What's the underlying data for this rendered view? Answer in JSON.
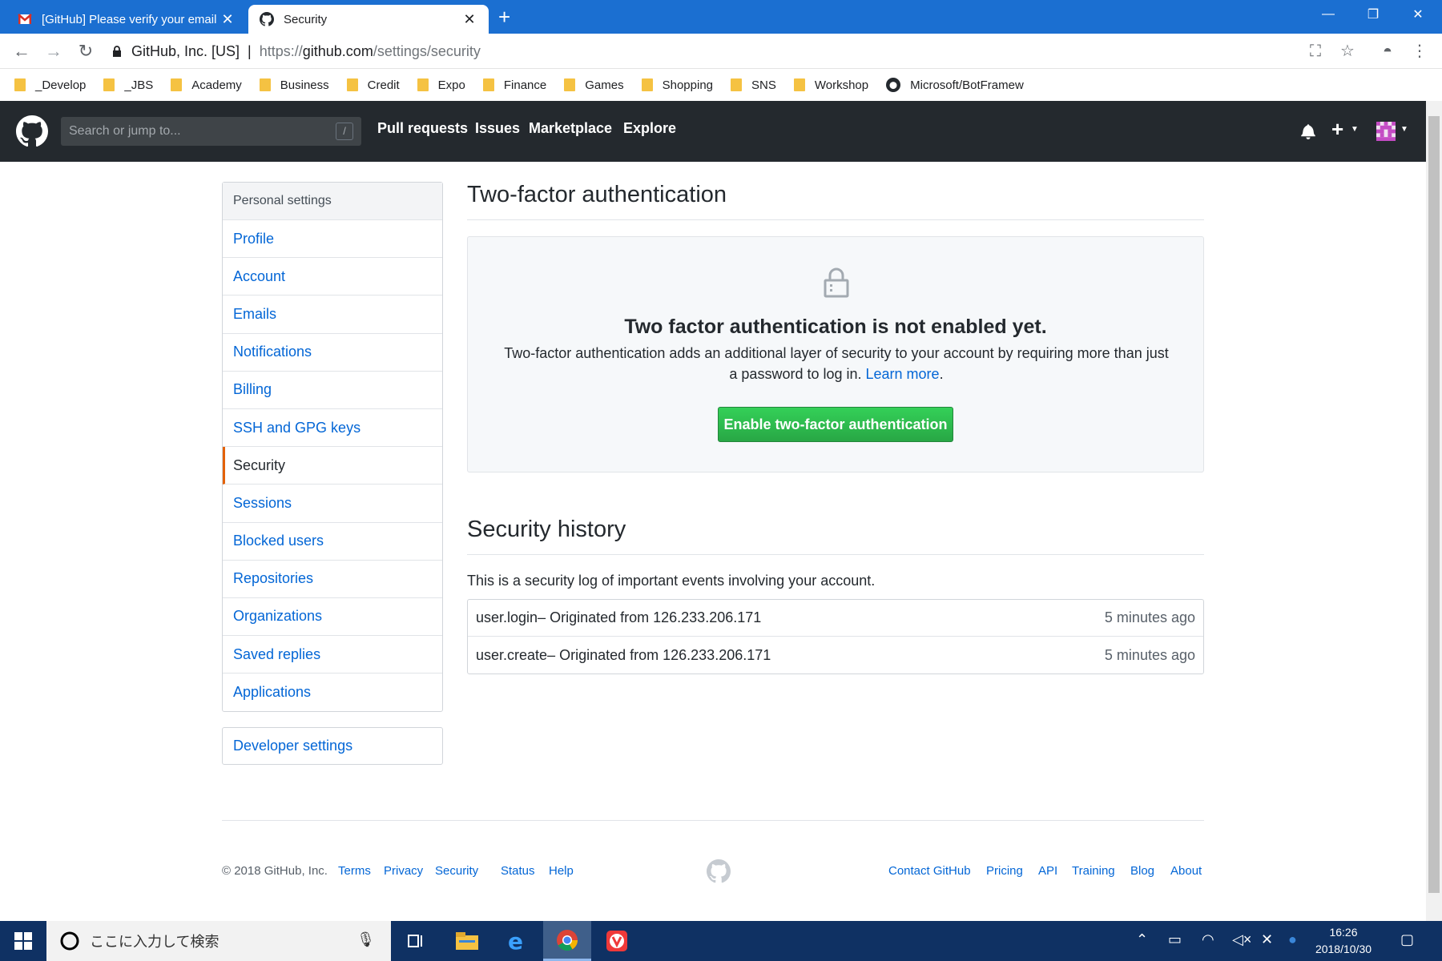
{
  "browser": {
    "tabs": [
      {
        "label": "[GitHub] Please verify your email",
        "icon": "gmail-icon",
        "active": false
      },
      {
        "label": "Security",
        "icon": "github-icon",
        "active": true
      }
    ],
    "address": {
      "org": "GitHub, Inc. [US]",
      "url_scheme": "https://",
      "url_host": "github.com",
      "url_path": "/settings/security"
    },
    "bookmarks": [
      {
        "label": "_Develop",
        "icon": "folder-icon"
      },
      {
        "label": "_JBS",
        "icon": "folder-icon"
      },
      {
        "label": "Academy",
        "icon": "folder-icon"
      },
      {
        "label": "Business",
        "icon": "folder-icon"
      },
      {
        "label": "Credit",
        "icon": "folder-icon"
      },
      {
        "label": "Expo",
        "icon": "folder-icon"
      },
      {
        "label": "Finance",
        "icon": "folder-icon"
      },
      {
        "label": "Games",
        "icon": "folder-icon"
      },
      {
        "label": "Shopping",
        "icon": "folder-icon"
      },
      {
        "label": "SNS",
        "icon": "folder-icon"
      },
      {
        "label": "Workshop",
        "icon": "folder-icon"
      },
      {
        "label": "Microsoft/BotFramew",
        "icon": "github-icon"
      }
    ]
  },
  "github": {
    "search_placeholder": "Search or jump to...",
    "search_shortcut": "/",
    "nav": [
      "Pull requests",
      "Issues",
      "Marketplace",
      "Explore"
    ],
    "sidebar": {
      "heading": "Personal settings",
      "items": [
        {
          "label": "Profile",
          "selected": false
        },
        {
          "label": "Account",
          "selected": false
        },
        {
          "label": "Emails",
          "selected": false
        },
        {
          "label": "Notifications",
          "selected": false
        },
        {
          "label": "Billing",
          "selected": false
        },
        {
          "label": "SSH and GPG keys",
          "selected": false
        },
        {
          "label": "Security",
          "selected": true
        },
        {
          "label": "Sessions",
          "selected": false
        },
        {
          "label": "Blocked users",
          "selected": false
        },
        {
          "label": "Repositories",
          "selected": false
        },
        {
          "label": "Organizations",
          "selected": false
        },
        {
          "label": "Saved replies",
          "selected": false
        },
        {
          "label": "Applications",
          "selected": false
        }
      ],
      "developer_settings": "Developer settings"
    },
    "two_factor": {
      "title": "Two-factor authentication",
      "blank_heading": "Two factor authentication is not enabled yet.",
      "description": "Two-factor authentication adds an additional layer of security to your account by requiring more than just a password to log in.",
      "learn_more": "Learn more",
      "button": "Enable two-factor authentication"
    },
    "security_history": {
      "title": "Security history",
      "description": "This is a security log of important events involving your account.",
      "events": [
        {
          "action": "user.login",
          "detail": " – Originated from 126.233.206.171",
          "time": "5 minutes ago"
        },
        {
          "action": "user.create",
          "detail": " – Originated from 126.233.206.171",
          "time": "5 minutes ago"
        }
      ]
    },
    "footer": {
      "copyright": "© 2018 GitHub, Inc.",
      "left_links": [
        "Terms",
        "Privacy",
        "Security",
        "Status",
        "Help"
      ],
      "right_links": [
        "Contact GitHub",
        "Pricing",
        "API",
        "Training",
        "Blog",
        "About"
      ]
    }
  },
  "taskbar": {
    "search_placeholder": "ここに入力して検索",
    "time": "16:26",
    "date": "2018/10/30"
  },
  "colors": {
    "titlebar": "#1b6fd1",
    "github_header": "#24292e",
    "link": "#0366d6",
    "primary_button": "#28a745",
    "selected_accent": "#e36209"
  }
}
